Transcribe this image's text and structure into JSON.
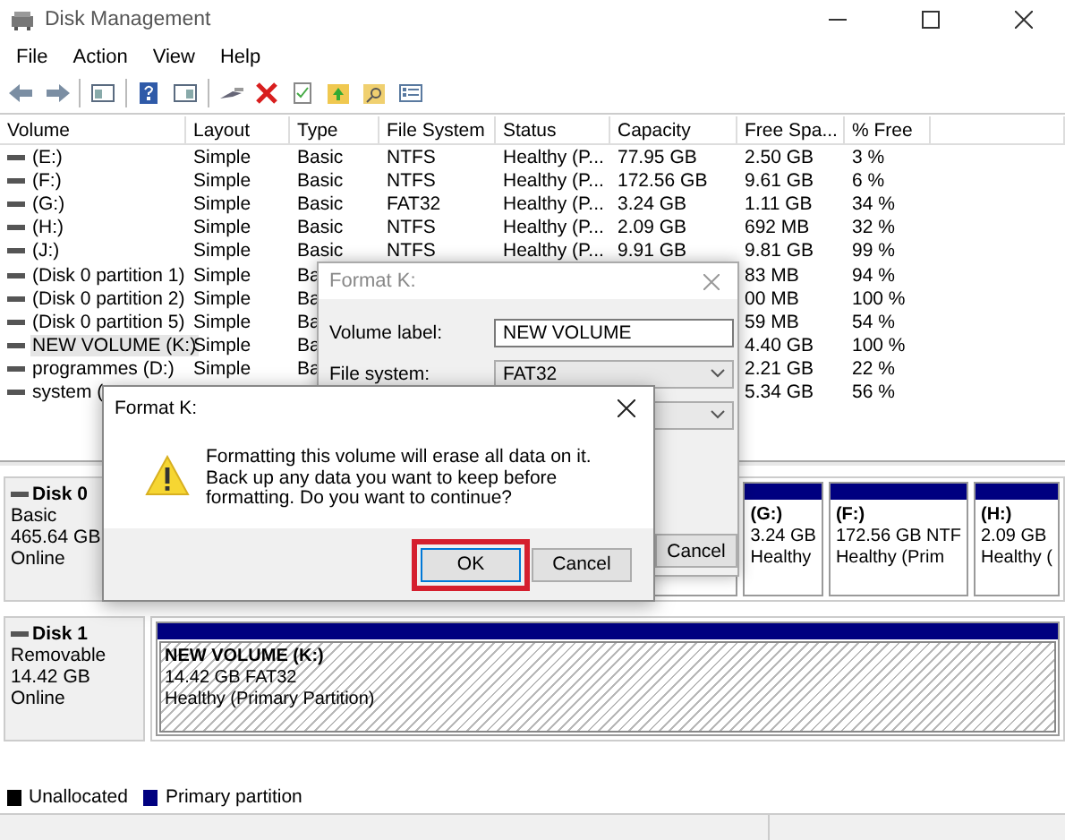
{
  "window": {
    "title": "Disk Management"
  },
  "menu": [
    "File",
    "Action",
    "View",
    "Help"
  ],
  "volume_table": {
    "columns": [
      "Volume",
      "Layout",
      "Type",
      "File System",
      "Status",
      "Capacity",
      "Free Spa...",
      "% Free"
    ],
    "rows": [
      {
        "cells": [
          "(E:)",
          "Simple",
          "Basic",
          "NTFS",
          "Healthy (P...",
          "77.95 GB",
          "2.50 GB",
          "3 %"
        ],
        "selected": false
      },
      {
        "cells": [
          "(F:)",
          "Simple",
          "Basic",
          "NTFS",
          "Healthy (P...",
          "172.56 GB",
          "9.61 GB",
          "6 %"
        ],
        "selected": false
      },
      {
        "cells": [
          "(G:)",
          "Simple",
          "Basic",
          "FAT32",
          "Healthy (P...",
          "3.24 GB",
          "1.11 GB",
          "34 %"
        ],
        "selected": false
      },
      {
        "cells": [
          "(H:)",
          "Simple",
          "Basic",
          "NTFS",
          "Healthy (P...",
          "2.09 GB",
          "692 MB",
          "32 %"
        ],
        "selected": false
      },
      {
        "cells": [
          "(J:)",
          "Simple",
          "Basic",
          "NTFS",
          "Healthy (P...",
          "9.91 GB",
          "9.81 GB",
          "99 %"
        ],
        "selected": false
      },
      {
        "cells": [
          "(Disk 0 partition 1)",
          "Simple",
          "Ba",
          null,
          null,
          null,
          "83 MB",
          "94 %"
        ],
        "selected": false
      },
      {
        "cells": [
          "(Disk 0 partition 2)",
          "Simple",
          "Ba",
          null,
          null,
          null,
          "00 MB",
          "100 %"
        ],
        "selected": false
      },
      {
        "cells": [
          "(Disk 0 partition 5)",
          "Simple",
          "Ba",
          null,
          null,
          null,
          "59 MB",
          "54 %"
        ],
        "selected": false
      },
      {
        "cells": [
          "NEW VOLUME (K:)",
          "Simple",
          "Ba",
          null,
          null,
          null,
          "4.40 GB",
          "100 %"
        ],
        "selected": true
      },
      {
        "cells": [
          "programmes (D:)",
          "Simple",
          "Ba",
          null,
          null,
          null,
          "2.21 GB",
          "22 %"
        ],
        "selected": false
      },
      {
        "cells": [
          "system (",
          null,
          null,
          null,
          null,
          null,
          "5.34 GB",
          "56 %"
        ],
        "selected": false
      }
    ]
  },
  "disks": [
    {
      "name": "Disk 0",
      "lines": [
        "Basic",
        "465.64 GB",
        "Online"
      ],
      "partitions": [
        {
          "lines": [
            "(G:)",
            "3.24 GB",
            "Healthy"
          ],
          "selected": false
        },
        {
          "lines": [
            "(F:)",
            "172.56 GB NTF",
            "Healthy (Prim"
          ],
          "selected": false
        },
        {
          "lines": [
            "(H:)",
            "2.09 GB",
            "Healthy ("
          ],
          "selected": false
        }
      ]
    },
    {
      "name": "Disk 1",
      "lines": [
        "Removable",
        "14.42 GB",
        "Online"
      ],
      "partitions": [
        {
          "lines": [
            "NEW VOLUME  (K:)",
            "14.42 GB FAT32",
            "Healthy (Primary Partition)"
          ],
          "selected": true
        }
      ]
    }
  ],
  "legend": [
    {
      "label": "Unallocated",
      "color": "#000000"
    },
    {
      "label": "Primary partition",
      "color": "#000080"
    }
  ],
  "format_dialog": {
    "title": "Format K:",
    "fields": [
      {
        "kind": "text",
        "label": "Volume label:",
        "value": "NEW VOLUME"
      },
      {
        "kind": "select",
        "label": "File system:",
        "value": "FAT32"
      },
      {
        "kind": "select"
      }
    ],
    "buttons": [
      "Cancel"
    ]
  },
  "confirm_dialog": {
    "title": "Format K:",
    "message": "Formatting this volume will erase all data on it. Back up any data you want to keep before formatting. Do you want to continue?",
    "buttons": [
      {
        "label": "OK",
        "highlighted": true
      },
      {
        "label": "Cancel",
        "highlighted": false
      }
    ]
  }
}
